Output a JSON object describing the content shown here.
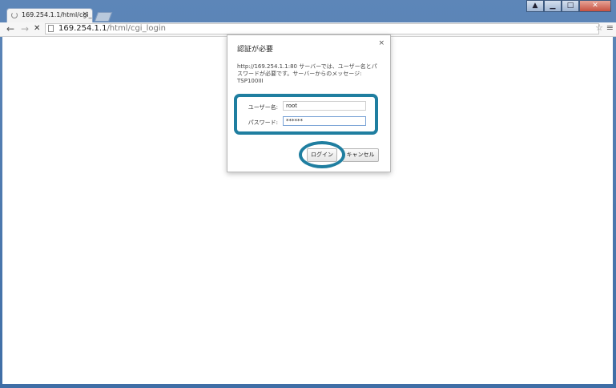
{
  "browser": {
    "tab_title": "169.254.1.1/html/cgi_",
    "tab_close": "×",
    "url_host": "169.254.1.1",
    "url_path": "/html/cgi_login",
    "nav_back": "←",
    "nav_forward": "→",
    "nav_stop": "✕",
    "star": "☆",
    "menu": "≡",
    "win_min": "▁",
    "win_max": "□",
    "win_close": "✕",
    "win_extra": "▲"
  },
  "dialog": {
    "title": "認証が必要",
    "close": "×",
    "message": "http://169.254.1.1:80 サーバーでは、ユーザー名とパスワードが必要です。サーバーからのメッセージ: TSP100III",
    "username_label": "ユーザー名:",
    "username_value": "root",
    "password_label": "パスワード:",
    "password_value": "******",
    "login_button": "ログイン",
    "cancel_button": "キャンセル"
  },
  "colors": {
    "highlight": "#1f7ea0",
    "frame": "#4f7bb3"
  }
}
